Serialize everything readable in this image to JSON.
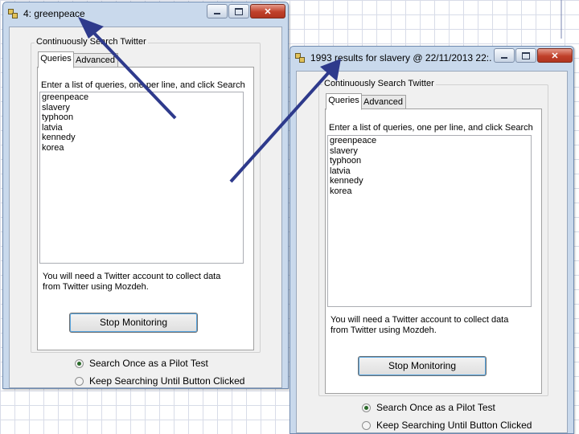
{
  "windows": [
    {
      "title": "4: greenpeace",
      "groupbox_title": "Continuously Search Twitter",
      "tabs": [
        "Queries",
        "Advanced"
      ],
      "instructions": "Enter a list of queries, one per line, and click Search",
      "queries": [
        "greenpeace",
        "slavery",
        "typhoon",
        "latvia",
        "kennedy",
        "korea"
      ],
      "note_line1": "You will need a Twitter account to collect data",
      "note_line2": "from Twitter using Mozdeh.",
      "button_label": "Stop Monitoring",
      "radio_options": [
        "Search Once as a Pilot Test",
        "Keep Searching Until Button Clicked"
      ],
      "radio_selected": 0
    },
    {
      "title": "1993 results for slavery @  22/11/2013 22:...",
      "groupbox_title": "Continuously Search Twitter",
      "tabs": [
        "Queries",
        "Advanced"
      ],
      "instructions": "Enter a list of queries, one per line, and click Search",
      "queries": [
        "greenpeace",
        "slavery",
        "typhoon",
        "latvia",
        "kennedy",
        "korea"
      ],
      "note_line1": "You will need a Twitter account to collect data",
      "note_line2": "from Twitter using Mozdeh.",
      "button_label": "Stop Monitoring",
      "radio_options": [
        "Search Once as a Pilot Test",
        "Keep Searching Until Button Clicked"
      ],
      "radio_selected": 0
    }
  ],
  "window_controls": {
    "minimize": "minimize-icon",
    "maximize": "maximize-icon",
    "close": "close-icon"
  },
  "colors": {
    "arrow": "#2e3a8c",
    "close_button": "#c0402a",
    "title_bar": "#c9d9ec"
  }
}
